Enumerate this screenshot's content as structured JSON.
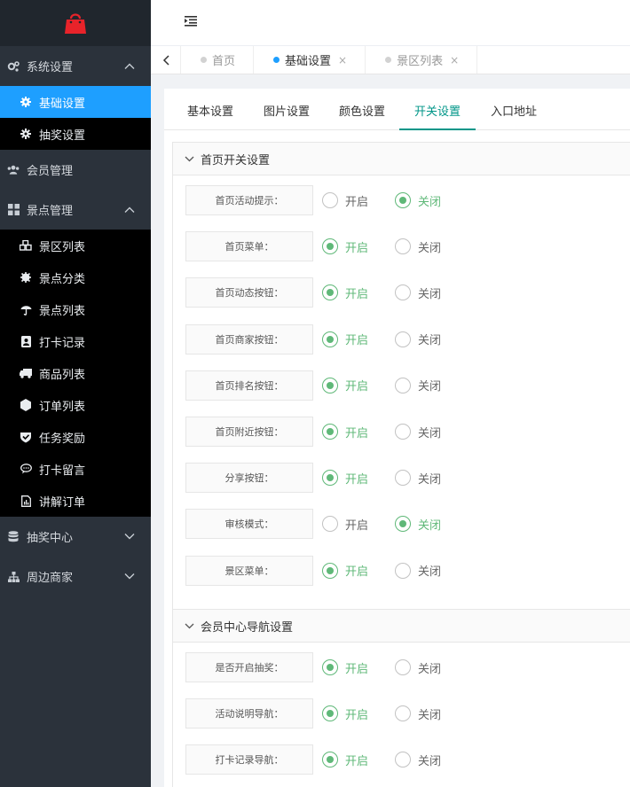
{
  "colors": {
    "accent": "#1e9fff",
    "radio_on": "#5fb878",
    "tab_active": "#009688",
    "sidebar_bg": "#2b323b",
    "submenu_bg": "#000000"
  },
  "sidebar": {
    "groups": [
      {
        "label": "系统设置",
        "icon": "gears-icon",
        "expanded": true,
        "items": [
          {
            "label": "基础设置",
            "icon": "gear-icon",
            "active": true
          },
          {
            "label": "抽奖设置",
            "icon": "gear-icon",
            "active": false
          }
        ]
      },
      {
        "label": "会员管理",
        "icon": "users-icon",
        "expanded": false,
        "items": []
      },
      {
        "label": "景点管理",
        "icon": "grid-icon",
        "expanded": true,
        "items": [
          {
            "label": "景区列表",
            "icon": "cubes-icon"
          },
          {
            "label": "景点分类",
            "icon": "asterisk-icon"
          },
          {
            "label": "景点列表",
            "icon": "umbrella-icon"
          },
          {
            "label": "打卡记录",
            "icon": "contact-card-icon"
          },
          {
            "label": "商品列表",
            "icon": "truck-icon"
          },
          {
            "label": "订单列表",
            "icon": "hexagon-icon"
          },
          {
            "label": "任务奖励",
            "icon": "shield-check-icon"
          },
          {
            "label": "打卡留言",
            "icon": "comment-icon"
          },
          {
            "label": "讲解订单",
            "icon": "document-chart-icon"
          }
        ]
      },
      {
        "label": "抽奖中心",
        "icon": "database-icon",
        "expanded": false,
        "items": []
      },
      {
        "label": "周边商家",
        "icon": "sitemap-icon",
        "expanded": false,
        "items": []
      }
    ]
  },
  "tabs": [
    {
      "label": "首页",
      "closable": false,
      "current": false
    },
    {
      "label": "基础设置",
      "closable": true,
      "current": true
    },
    {
      "label": "景区列表",
      "closable": true,
      "current": false
    }
  ],
  "close_glyph": "×",
  "settings_tabs": [
    "基本设置",
    "图片设置",
    "颜色设置",
    "开关设置",
    "入口地址"
  ],
  "active_settings_tab": 3,
  "option_labels": {
    "on": "开启",
    "off": "关闭"
  },
  "sections": [
    {
      "title": "首页开关设置",
      "rows": [
        {
          "label": "首页活动提示：",
          "enabled": false
        },
        {
          "label": "首页菜单：",
          "enabled": true
        },
        {
          "label": "首页动态按钮：",
          "enabled": true
        },
        {
          "label": "首页商家按钮：",
          "enabled": true
        },
        {
          "label": "首页排名按钮：",
          "enabled": true
        },
        {
          "label": "首页附近按钮：",
          "enabled": true
        },
        {
          "label": "分享按钮：",
          "enabled": true
        },
        {
          "label": "审核模式：",
          "enabled": false
        },
        {
          "label": "景区菜单：",
          "enabled": true
        }
      ]
    },
    {
      "title": "会员中心导航设置",
      "rows": [
        {
          "label": "是否开启抽奖：",
          "enabled": true
        },
        {
          "label": "活动说明导航：",
          "enabled": true
        },
        {
          "label": "打卡记录导航：",
          "enabled": true
        }
      ]
    }
  ]
}
